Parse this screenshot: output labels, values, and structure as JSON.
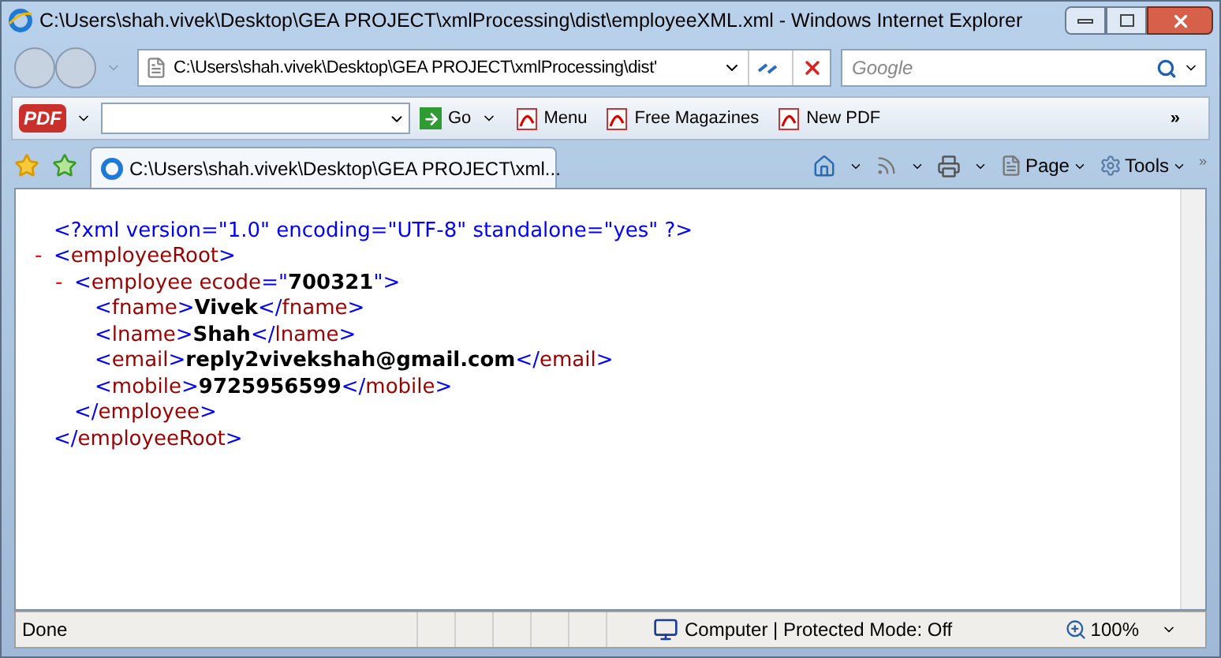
{
  "window": {
    "title": "C:\\Users\\shah.vivek\\Desktop\\GEA PROJECT\\xmlProcessing\\dist\\employeeXML.xml - Windows Internet Explorer"
  },
  "address_bar": {
    "value": "C:\\Users\\shah.vivek\\Desktop\\GEA PROJECT\\xmlProcessing\\dist'"
  },
  "search": {
    "placeholder": "Google"
  },
  "pdf_toolbar": {
    "logo": "PDF",
    "go": "Go",
    "items": [
      "Menu",
      "Free Magazines",
      "New PDF"
    ],
    "overflow": "»"
  },
  "tabs": [
    {
      "label": "C:\\Users\\shah.vivek\\Desktop\\GEA PROJECT\\xml...",
      "selected": true
    }
  ],
  "command_bar": {
    "page": "Page",
    "tools": "Tools",
    "overflow": "»"
  },
  "xml": [
    {
      "tokens": [
        {
          "kind": "pi",
          "text": "<?xml version=\"1.0\" encoding=\"UTF-8\" standalone=\"yes\" ?>"
        }
      ]
    },
    {
      "toggle": "-",
      "tokens": [
        {
          "kind": "punct",
          "text": "<"
        },
        {
          "kind": "tag",
          "text": "employeeRoot"
        },
        {
          "kind": "punct",
          "text": ">"
        }
      ],
      "children": [
        {
          "toggle": "-",
          "tokens": [
            {
              "kind": "punct",
              "text": "<"
            },
            {
              "kind": "tag",
              "text": "employee ecode"
            },
            {
              "kind": "punct",
              "text": "=\""
            },
            {
              "kind": "value",
              "text": "700321"
            },
            {
              "kind": "punct",
              "text": "\">"
            }
          ],
          "children": [
            {
              "tokens": [
                {
                  "kind": "punct",
                  "text": "<"
                },
                {
                  "kind": "tag",
                  "text": "fname"
                },
                {
                  "kind": "punct",
                  "text": ">"
                },
                {
                  "kind": "value",
                  "text": "Vivek"
                },
                {
                  "kind": "punct",
                  "text": "</"
                },
                {
                  "kind": "tag",
                  "text": "fname"
                },
                {
                  "kind": "punct",
                  "text": ">"
                }
              ]
            },
            {
              "tokens": [
                {
                  "kind": "punct",
                  "text": "<"
                },
                {
                  "kind": "tag",
                  "text": "lname"
                },
                {
                  "kind": "punct",
                  "text": ">"
                },
                {
                  "kind": "value",
                  "text": "Shah"
                },
                {
                  "kind": "punct",
                  "text": "</"
                },
                {
                  "kind": "tag",
                  "text": "lname"
                },
                {
                  "kind": "punct",
                  "text": ">"
                }
              ]
            },
            {
              "tokens": [
                {
                  "kind": "punct",
                  "text": "<"
                },
                {
                  "kind": "tag",
                  "text": "email"
                },
                {
                  "kind": "punct",
                  "text": ">"
                },
                {
                  "kind": "value",
                  "text": "reply2vivekshah@gmail.com"
                },
                {
                  "kind": "punct",
                  "text": "</"
                },
                {
                  "kind": "tag",
                  "text": "email"
                },
                {
                  "kind": "punct",
                  "text": ">"
                }
              ]
            },
            {
              "tokens": [
                {
                  "kind": "punct",
                  "text": "<"
                },
                {
                  "kind": "tag",
                  "text": "mobile"
                },
                {
                  "kind": "punct",
                  "text": ">"
                },
                {
                  "kind": "value",
                  "text": "9725956599"
                },
                {
                  "kind": "punct",
                  "text": "</"
                },
                {
                  "kind": "tag",
                  "text": "mobile"
                },
                {
                  "kind": "punct",
                  "text": ">"
                }
              ]
            }
          ],
          "close": [
            {
              "kind": "punct",
              "text": "</"
            },
            {
              "kind": "tag",
              "text": "employee"
            },
            {
              "kind": "punct",
              "text": ">"
            }
          ]
        }
      ],
      "close": [
        {
          "kind": "punct",
          "text": "</"
        },
        {
          "kind": "tag",
          "text": "employeeRoot"
        },
        {
          "kind": "punct",
          "text": ">"
        }
      ]
    }
  ],
  "status_bar": {
    "status": "Done",
    "zone": "Computer | Protected Mode: Off",
    "zoom": "100%"
  }
}
